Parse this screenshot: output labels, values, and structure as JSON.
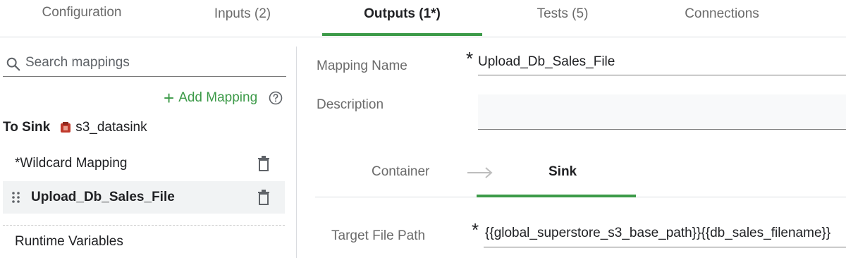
{
  "tabs": [
    {
      "label": "Configuration",
      "active": false
    },
    {
      "label": "Inputs (2)",
      "active": false
    },
    {
      "label": "Outputs (1*)",
      "active": true
    },
    {
      "label": "Tests (5)",
      "active": false
    },
    {
      "label": "Connections",
      "active": false
    }
  ],
  "sidebar": {
    "search_placeholder": "Search mappings",
    "add_mapping_label": "Add Mapping",
    "to_sink_label": "To Sink",
    "sink_name": "s3_datasink",
    "mappings": [
      {
        "label": "*Wildcard Mapping",
        "selected": false
      },
      {
        "label": "Upload_Db_Sales_File",
        "selected": true
      }
    ],
    "runtime_variables_label": "Runtime Variables"
  },
  "detail": {
    "mapping_name_label": "Mapping Name",
    "mapping_name_value": "Upload_Db_Sales_File",
    "description_label": "Description",
    "description_value": "",
    "required_marker": "*",
    "subtabs": [
      {
        "label": "Container",
        "active": false
      },
      {
        "label": "Sink",
        "active": true
      }
    ],
    "target_file_path_label": "Target File Path",
    "target_file_path_value": "{{global_superstore_s3_base_path}}{{db_sales_filename}}"
  },
  "colors": {
    "accent": "#3c9a48",
    "selected_row": "#f1f3f4"
  },
  "icons": [
    "search-icon",
    "plus-icon",
    "help-icon",
    "s3-bucket-icon",
    "drag-handle-icon",
    "trash-icon",
    "arrow-right-icon"
  ]
}
